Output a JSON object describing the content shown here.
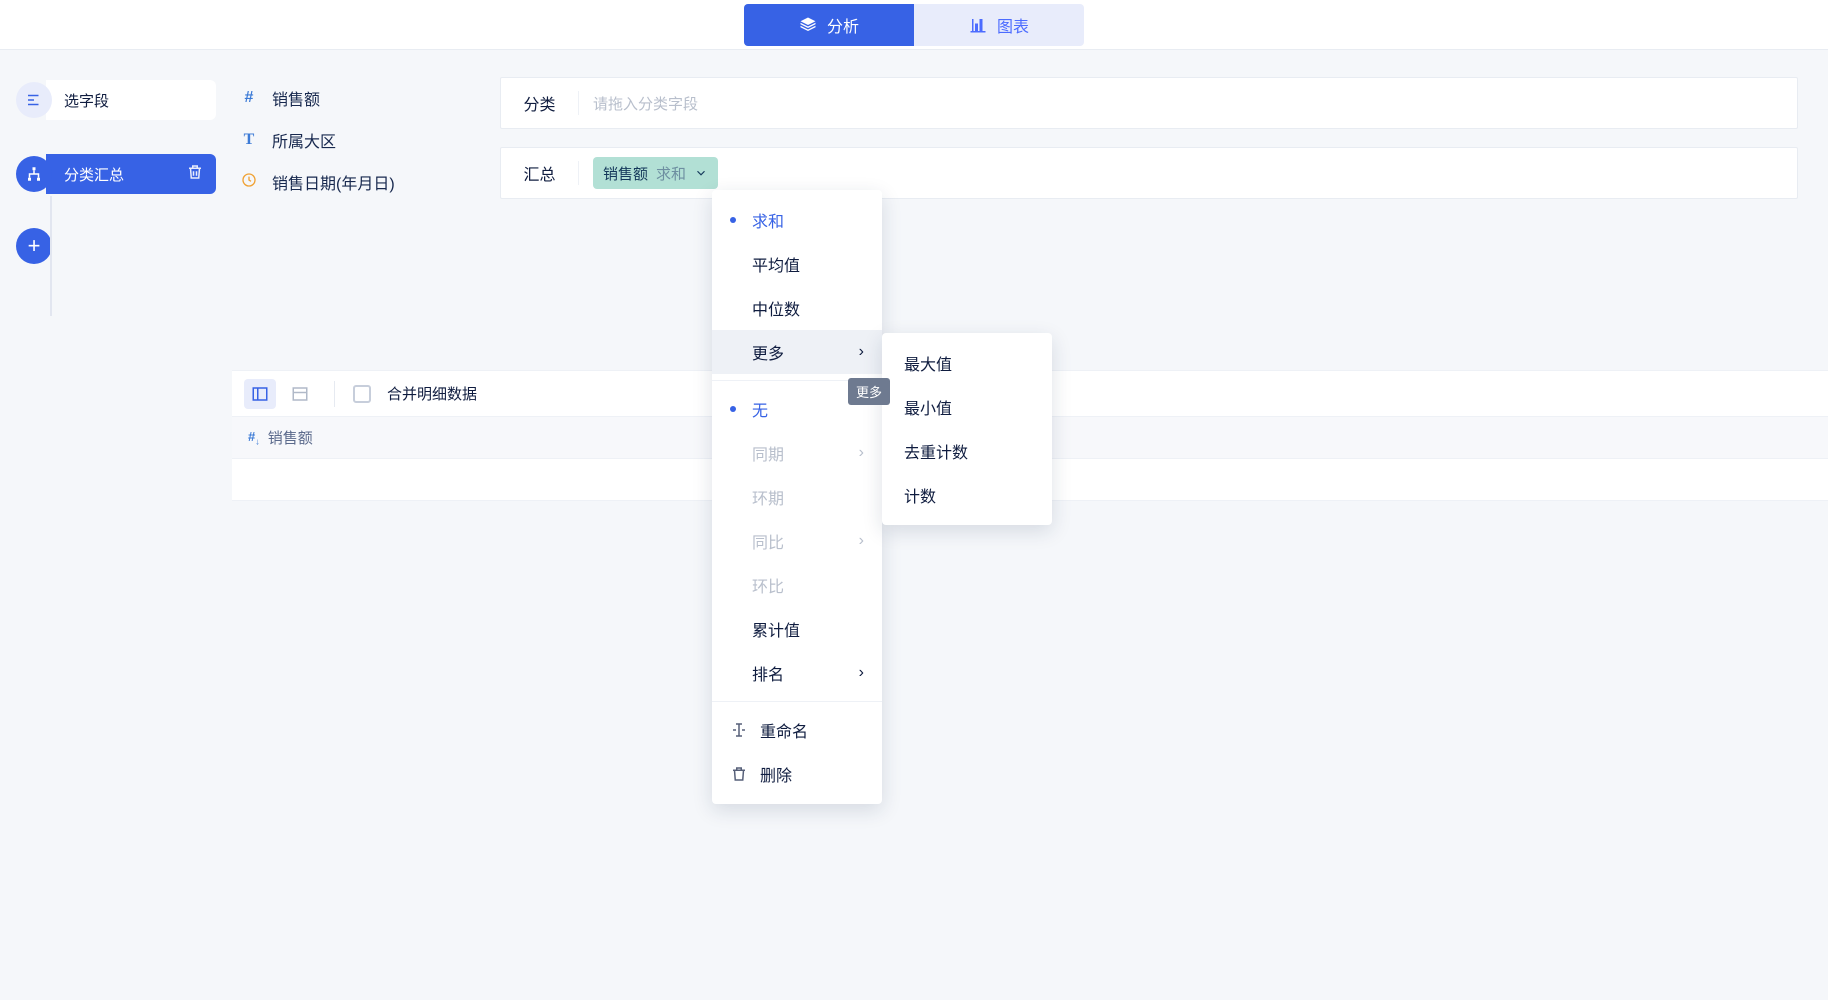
{
  "top_tabs": {
    "analysis": "分析",
    "chart": "图表"
  },
  "steps": {
    "select_fields": "选字段",
    "group_summary": "分类汇总"
  },
  "fields": {
    "sales_amount": "销售额",
    "region": "所属大区",
    "sale_date": "销售日期(年月日)"
  },
  "zones": {
    "category_label": "分类",
    "category_placeholder": "请拖入分类字段",
    "summary_label": "汇总"
  },
  "chip": {
    "name": "销售额",
    "agg": "求和"
  },
  "toolbar": {
    "merge_label": "合并明细数据"
  },
  "table": {
    "col_header": "销售额"
  },
  "menu": {
    "sum": "求和",
    "avg": "平均值",
    "median": "中位数",
    "more": "更多",
    "none": "无",
    "same_period": "同期",
    "ring_period": "环期",
    "yoy": "同比",
    "mom": "环比",
    "cumulative": "累计值",
    "rank": "排名",
    "rename": "重命名",
    "delete": "删除"
  },
  "submenu": {
    "max": "最大值",
    "min": "最小值",
    "distinct_count": "去重计数",
    "count": "计数"
  },
  "tooltip_more": "更多"
}
